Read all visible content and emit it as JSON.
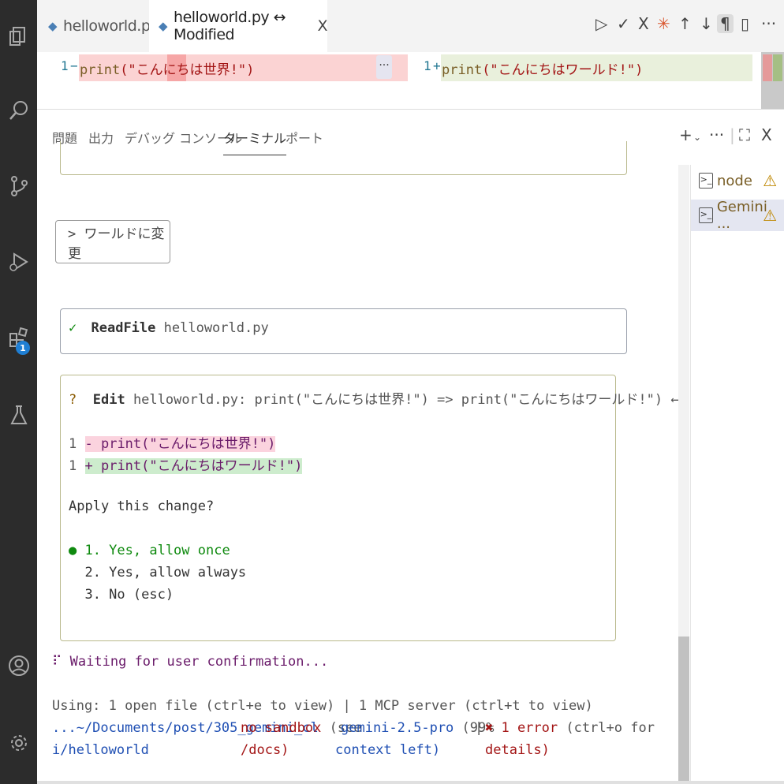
{
  "tabs": [
    {
      "label": "helloworld.py"
    },
    {
      "label": "helloworld.py ↔ Modified",
      "close": "X"
    }
  ],
  "toolbar_icons": [
    "run-icon",
    "check-icon",
    "x-icon",
    "gemini-spark-icon",
    "arrow-up-icon",
    "arrow-down-icon",
    "pilcrow-icon",
    "split-icon",
    "more-icon"
  ],
  "diff": {
    "left": {
      "line": "1",
      "marker": "−",
      "code_fn": "print",
      "code_str": "(\"こんにちは世界!\")"
    },
    "right": {
      "line": "1",
      "marker": "+",
      "code_fn": "print",
      "code_str": "(\"こんにちはワールド!\")"
    },
    "dots": "···"
  },
  "panel": {
    "tabs": [
      "問題",
      "出力",
      "デバッグ コンソール",
      "ターミナル",
      "ポート"
    ],
    "active_tab": "ターミナル"
  },
  "terminals": [
    {
      "name": "node"
    },
    {
      "name": "Gemini ..."
    }
  ],
  "terminal": {
    "prompt": "> ワールドに変更",
    "readfile": {
      "check": "✓",
      "tool": "ReadFile",
      "file": "helloworld.py"
    },
    "edit": {
      "question": "?",
      "tool": "Edit",
      "desc": "helloworld.py: print(\"こんにちは世界!\") => print(\"こんにちはワールド!\") ←",
      "del_num": "1",
      "del_line": "- print(\"こんにちは世界!\")",
      "add_num": "1",
      "add_line": "+ print(\"こんにちはワールド!\")",
      "apply": "Apply this change?",
      "options": [
        "● 1. Yes, allow once",
        "  2. Yes, allow always",
        "  3. No (esc)"
      ]
    },
    "waiting": "⠏ Waiting for user confirmation...",
    "using": "Using: 1 open file (ctrl+e to view) | 1 MCP server (ctrl+t to view)",
    "status": {
      "path1": "...~/Documents/post/305_gemini_cl",
      "path2": "i/helloworld",
      "sandbox1": "no sandbox",
      "sandbox_see1": " (see",
      "sandbox2": "/docs)",
      "model1": "gemini-2.5-pro",
      "model_pct": " (99%",
      "model2": "context left)",
      "sep": "|",
      "error1": "✖ 1 error",
      "error_hint": " (ctrl+o for",
      "error2": "details)"
    }
  },
  "activity_badge": "1",
  "colors": {
    "accent": "#1f7fd4",
    "activity_bg": "#2c2c2c",
    "diff_del": "#fbd3d3",
    "diff_add": "#e9f0dc"
  }
}
